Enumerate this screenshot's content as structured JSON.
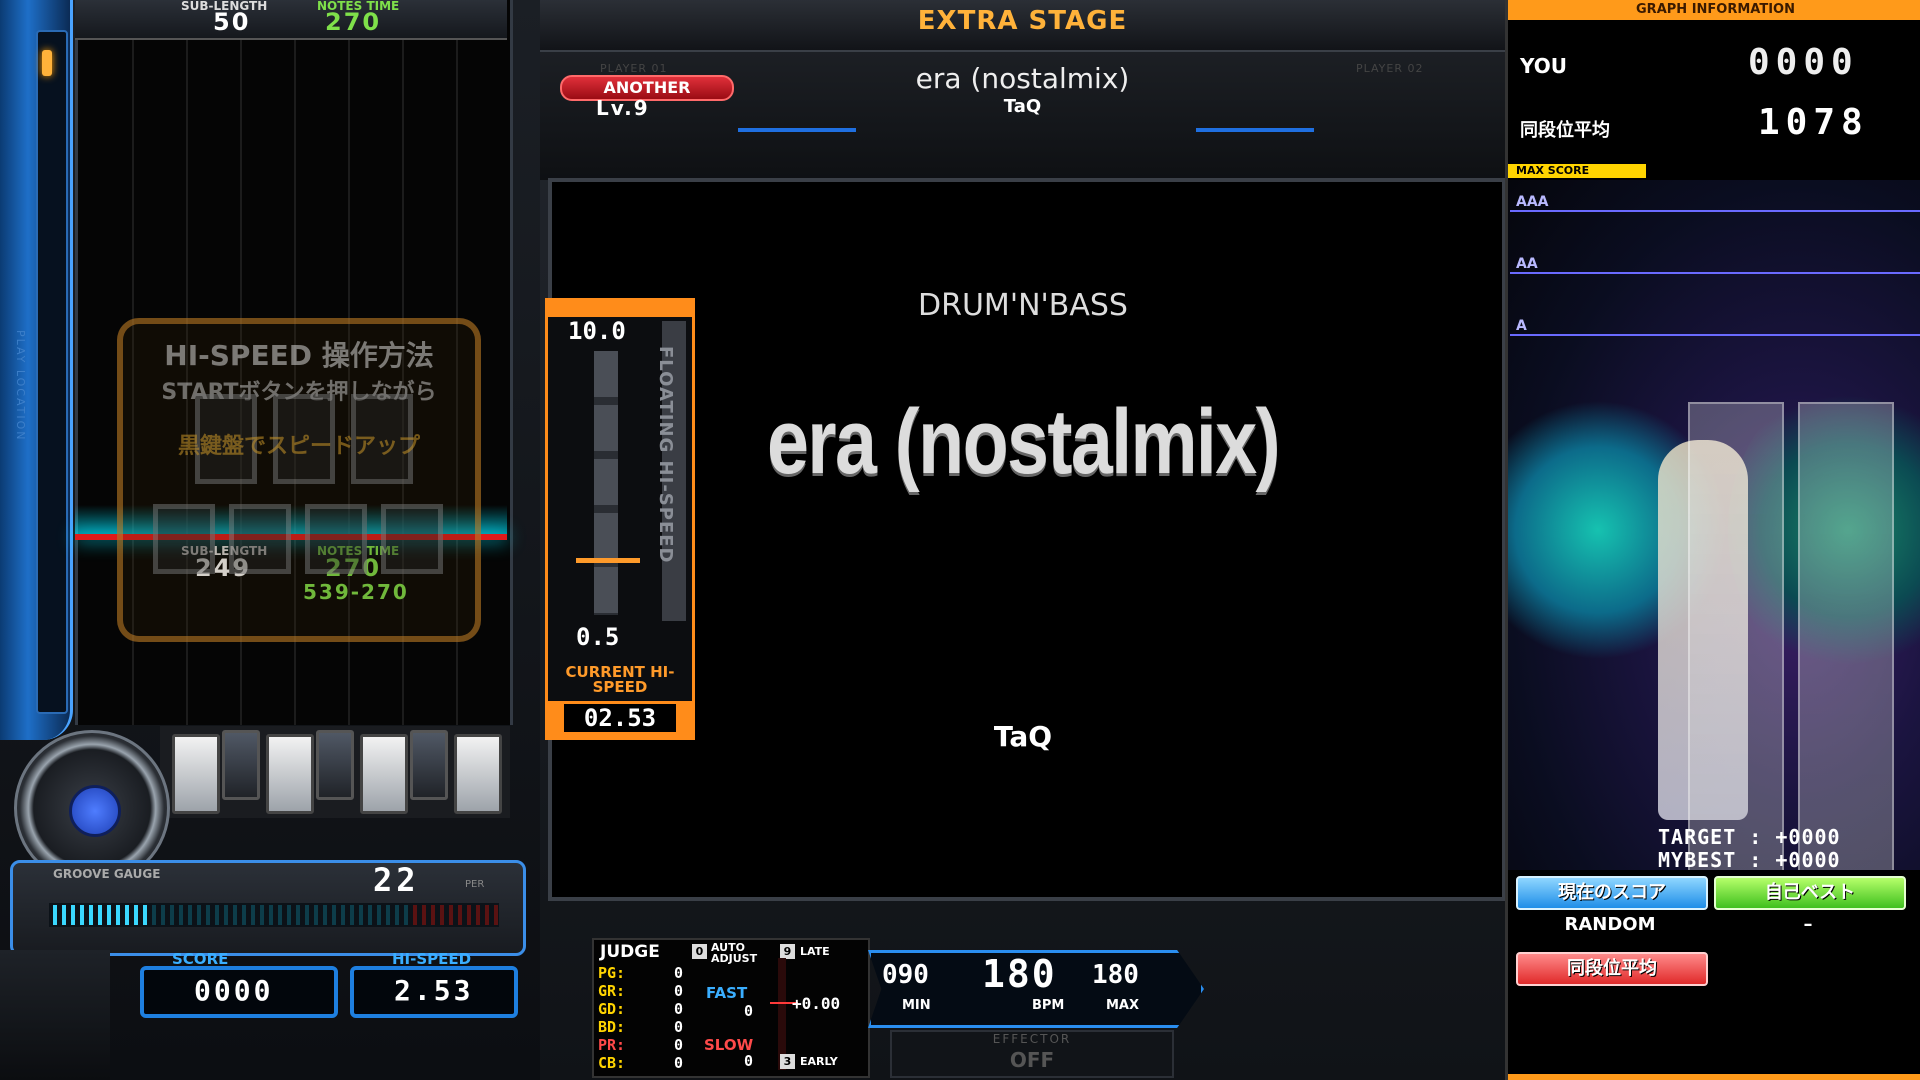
{
  "lanes": {
    "top": {
      "sub_length_label": "SUB-LENGTH",
      "sub_length": "50",
      "notes_time_label": "NOTES TIME",
      "notes_time": "270"
    },
    "judge": {
      "sub_length_label": "SUB-LENGTH",
      "sub_length": "249",
      "notes_time_label": "NOTES TIME",
      "notes_time": "270",
      "range": "539-270"
    },
    "play_location": "PLAY LOCATION",
    "guide": {
      "title": "HI-SPEED 操作方法",
      "line1": "STARTボタンを押しながら",
      "line2": "黒鍵盤でスピードアップ"
    }
  },
  "gauge": {
    "label": "GROOVE GAUGE",
    "value": "22",
    "unit": "PER",
    "fill_fraction": 0.22
  },
  "score_box": {
    "score_label": "SCORE",
    "score": "0000",
    "hispeed_label": "HI-SPEED",
    "hispeed": "2.53"
  },
  "stage": {
    "title": "EXTRA STAGE",
    "player1": "PLAYER 01",
    "player2": "PLAYER 02"
  },
  "song": {
    "difficulty": "ANOTHER",
    "level": "Lv.9",
    "title": "era (nostalmix)",
    "artist": "TaQ",
    "genre": "DRUM'N'BASS",
    "big_title": "era (nostalmix)"
  },
  "floating_hs": {
    "max": "10.0",
    "min": "0.5",
    "label": "FLOATING HI-SPEED",
    "current_label": "CURRENT HI-SPEED",
    "current": "02.53"
  },
  "judge": {
    "title": "JUDGE",
    "auto_adjust_key": "0",
    "auto_adjust": "AUTO ADJUST",
    "late_key": "9",
    "late": "LATE",
    "early_key": "3",
    "early": "EARLY",
    "rows": [
      {
        "label": "PG:",
        "value": "0",
        "color": "#ffd400"
      },
      {
        "label": "GR:",
        "value": "0",
        "color": "#ffd400"
      },
      {
        "label": "GD:",
        "value": "0",
        "color": "#ffd400"
      },
      {
        "label": "BD:",
        "value": "0",
        "color": "#ffd400"
      },
      {
        "label": "PR:",
        "value": "0",
        "color": "#ff4a4a"
      },
      {
        "label": "CB:",
        "value": "0",
        "color": "#ffd400"
      }
    ],
    "fast_label": "FAST",
    "fast": "0",
    "slow_label": "SLOW",
    "slow": "0",
    "adjust": "+0.00"
  },
  "bpm": {
    "min": "090",
    "current": "180",
    "max": "180",
    "min_label": "MIN",
    "bpm_label": "BPM",
    "max_label": "MAX"
  },
  "effector": {
    "label": "EFFECTOR",
    "value": "OFF"
  },
  "graph": {
    "header": "GRAPH INFORMATION",
    "you_label": "YOU",
    "you": "0000",
    "avg_label": "同段位平均",
    "avg": "1078",
    "max_score": "MAX SCORE",
    "ranks": [
      "AAA",
      "AA",
      "A"
    ],
    "target": "TARGET : +0000",
    "mybest": "MYBEST : +0000",
    "btn_current": "現在のスコア",
    "btn_best": "自己ベスト",
    "current_option": "RANDOM",
    "best_option": "–",
    "btn_avg": "同段位平均"
  },
  "colors": {
    "accent_orange": "#ff9a1a",
    "accent_blue": "#1e7fe0",
    "danger_red": "#e02a2a"
  }
}
